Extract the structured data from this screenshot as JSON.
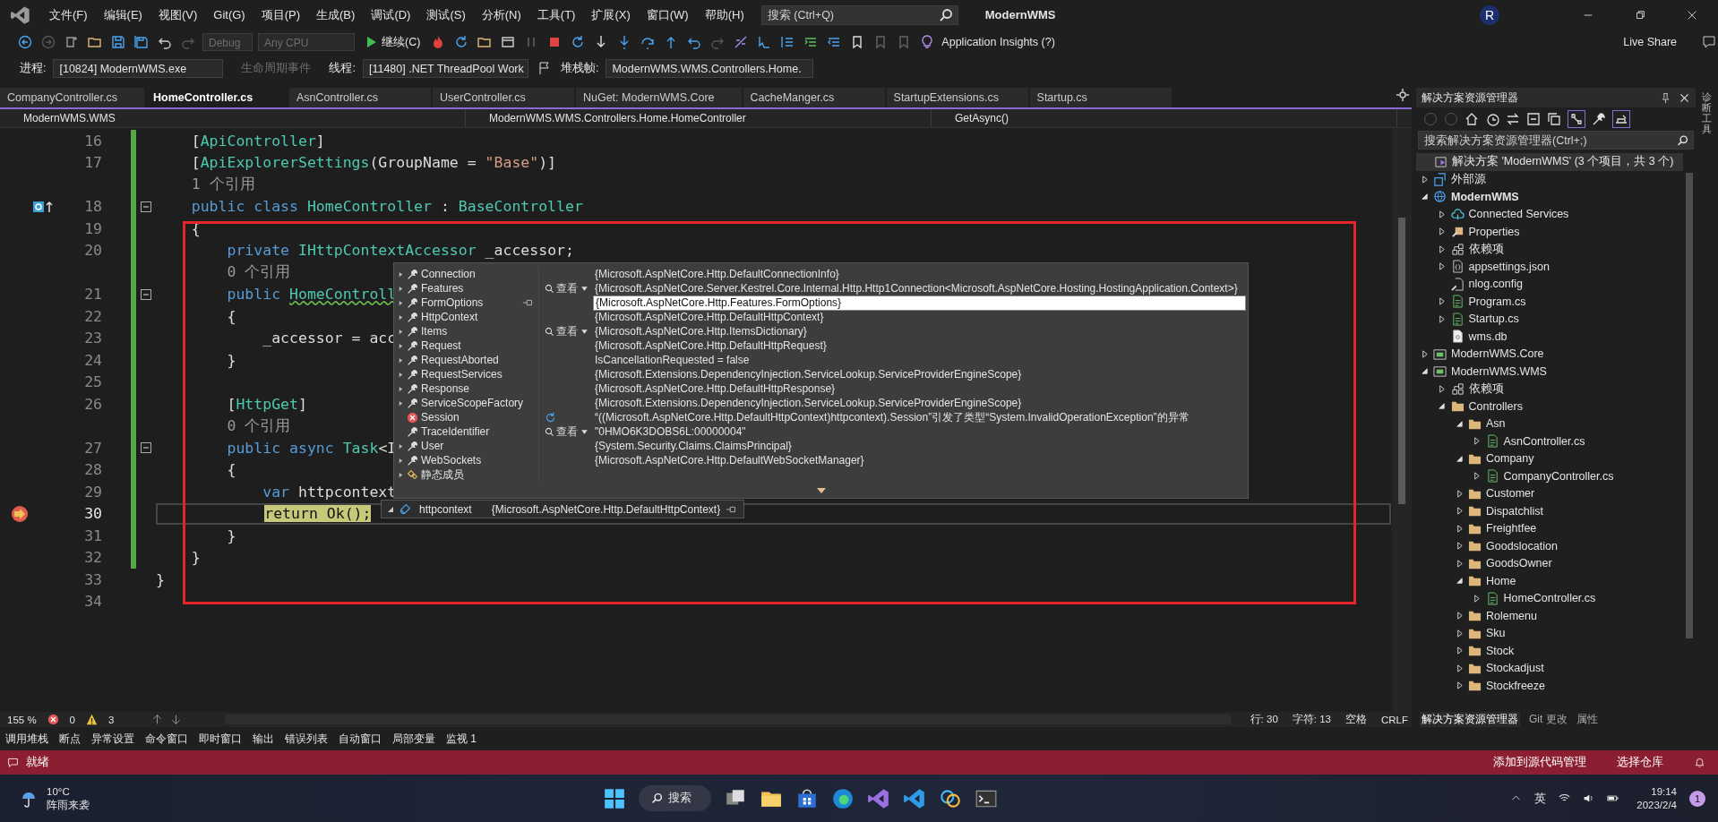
{
  "window": {
    "title": "ModernWMS",
    "account_initial": "R"
  },
  "menu": [
    "文件(F)",
    "编辑(E)",
    "视图(V)",
    "Git(G)",
    "项目(P)",
    "生成(B)",
    "调试(D)",
    "测试(S)",
    "分析(N)",
    "工具(T)",
    "扩展(X)",
    "窗口(W)",
    "帮助(H)"
  ],
  "search": {
    "placeholder": "搜索 (Ctrl+Q)"
  },
  "toolbar": {
    "configuration": {
      "value": "Debug",
      "disabled": true
    },
    "platform": {
      "value": "Any CPU",
      "disabled": true
    },
    "continue": "继续(C)",
    "insights": "Application Insights (?)",
    "live_share": "Live Share"
  },
  "debug_location": {
    "process_label": "进程:",
    "process": "[10824] ModernWMS.exe",
    "lifecycle": {
      "label": "生命周期事件",
      "disabled": true
    },
    "thread_label": "线程:",
    "thread": "[11480] .NET ThreadPool Work",
    "stack_label": "堆栈帧:",
    "stack_frame": "ModernWMS.WMS.Controllers.Home."
  },
  "tabs": [
    {
      "label": "CompanyController.cs",
      "selected": false
    },
    {
      "label": "HomeController.cs",
      "selected": true
    },
    {
      "label": "AsnController.cs",
      "selected": false
    },
    {
      "label": "UserController.cs",
      "selected": false
    },
    {
      "label": "NuGet: ModernWMS.Core",
      "selected": false
    },
    {
      "label": "CacheManger.cs",
      "selected": false
    },
    {
      "label": "StartupExtensions.cs",
      "selected": false
    },
    {
      "label": "Startup.cs",
      "selected": false
    }
  ],
  "navigation": {
    "project": "ModernWMS.WMS",
    "type": "ModernWMS.WMS.Controllers.Home.HomeController",
    "member": "GetAsync()"
  },
  "code_lines": [
    {
      "kind": "code",
      "number": "16",
      "changed": true,
      "tokens": [
        {
          "text": "    [",
          "kind": "plain"
        },
        {
          "text": "ApiController",
          "kind": "type"
        },
        {
          "text": "]",
          "kind": "plain"
        }
      ]
    },
    {
      "kind": "code",
      "number": "17",
      "changed": true,
      "tokens": [
        {
          "text": "    [",
          "kind": "plain"
        },
        {
          "text": "ApiExplorerSettings",
          "kind": "type"
        },
        {
          "text": "(GroupName = ",
          "kind": "plain"
        },
        {
          "text": "\"Base\"",
          "kind": "string"
        },
        {
          "text": ")]",
          "kind": "plain"
        }
      ]
    },
    {
      "kind": "lens",
      "changed": true,
      "text": "1 个引用"
    },
    {
      "kind": "code",
      "number": "18",
      "changed": true,
      "gutter": {
        "kind": "base-link"
      },
      "folded": false,
      "tokens": [
        {
          "text": "    public class ",
          "kind": "keyword"
        },
        {
          "text": "HomeController",
          "kind": "type"
        },
        {
          "text": " : ",
          "kind": "plain"
        },
        {
          "text": "BaseController",
          "kind": "type"
        }
      ]
    },
    {
      "kind": "code",
      "number": "19",
      "changed": true,
      "tokens": [
        {
          "text": "    {",
          "kind": "plain"
        }
      ]
    },
    {
      "kind": "code",
      "number": "20",
      "changed": true,
      "tokens": [
        {
          "text": "        private ",
          "kind": "keyword"
        },
        {
          "text": "IHttpContextAccessor",
          "kind": "type"
        },
        {
          "text": " _accessor;",
          "kind": "plain"
        }
      ]
    },
    {
      "kind": "lens",
      "changed": true,
      "text": "0 个引用"
    },
    {
      "kind": "code",
      "number": "21",
      "changed": true,
      "folded": false,
      "tokens": [
        {
          "text": "        public ",
          "kind": "keyword"
        },
        {
          "text": "HomeControll",
          "kind": "type",
          "warning": true
        }
      ]
    },
    {
      "kind": "code",
      "number": "22",
      "changed": true,
      "tokens": [
        {
          "text": "        {",
          "kind": "plain"
        }
      ]
    },
    {
      "kind": "code",
      "number": "23",
      "changed": true,
      "tokens": [
        {
          "text": "            _accessor = acc",
          "kind": "plain"
        }
      ]
    },
    {
      "kind": "code",
      "number": "24",
      "changed": true,
      "tokens": [
        {
          "text": "        }",
          "kind": "plain"
        }
      ]
    },
    {
      "kind": "code",
      "number": "25",
      "changed": true
    },
    {
      "kind": "code",
      "number": "26",
      "changed": true,
      "tokens": [
        {
          "text": "        [",
          "kind": "plain"
        },
        {
          "text": "HttpGet",
          "kind": "type"
        },
        {
          "text": "]",
          "kind": "plain"
        }
      ]
    },
    {
      "kind": "lens",
      "changed": true,
      "text": "0 个引用"
    },
    {
      "kind": "code",
      "number": "27",
      "changed": true,
      "folded": false,
      "tokens": [
        {
          "text": "        public async ",
          "kind": "keyword"
        },
        {
          "text": "Task",
          "kind": "type"
        },
        {
          "text": "<I",
          "kind": "plain"
        }
      ]
    },
    {
      "kind": "code",
      "number": "28",
      "changed": true,
      "tokens": [
        {
          "text": "        {",
          "kind": "plain"
        }
      ]
    },
    {
      "kind": "code",
      "number": "29",
      "changed": true,
      "tokens": [
        {
          "text": "            var",
          "kind": "keyword"
        },
        {
          "text": " httpcontext",
          "kind": "plain"
        }
      ]
    },
    {
      "kind": "code",
      "number": "30",
      "changed": true,
      "current": true,
      "gutter": {
        "kind": "current"
      },
      "tokens": [
        {
          "text": "            return",
          "kind": "keyword"
        },
        {
          "text": " Ok();",
          "kind": "plain"
        }
      ]
    },
    {
      "kind": "code",
      "number": "31",
      "changed": true,
      "tokens": [
        {
          "text": "        }",
          "kind": "plain"
        }
      ]
    },
    {
      "kind": "code",
      "number": "32",
      "changed": true,
      "tokens": [
        {
          "text": "    }",
          "kind": "plain"
        }
      ]
    },
    {
      "kind": "code",
      "number": "33",
      "changed": false,
      "tokens": [
        {
          "text": "}",
          "kind": "plain"
        }
      ]
    },
    {
      "kind": "code",
      "number": "34",
      "changed": false
    }
  ],
  "datatip": {
    "name": "httpcontext",
    "value": "{Microsoft.AspNetCore.Http.DefaultHttpContext}",
    "expanded": true,
    "members": [
      {
        "name": "Connection",
        "kind": "property",
        "expandable": true,
        "value": "{Microsoft.AspNetCore.Http.DefaultConnectionInfo}"
      },
      {
        "name": "Features",
        "kind": "property",
        "expandable": true,
        "action": "查看",
        "value": "{Microsoft.AspNetCore.Server.Kestrel.Core.Internal.Http.Http1Connection<Microsoft.AspNetCore.Hosting.HostingApplication.Context>}"
      },
      {
        "name": "FormOptions",
        "kind": "property",
        "expandable": true,
        "editing": true,
        "value": "{Microsoft.AspNetCore.Http.Features.FormOptions}"
      },
      {
        "name": "HttpContext",
        "kind": "property",
        "expandable": true,
        "value": "{Microsoft.AspNetCore.Http.DefaultHttpContext}"
      },
      {
        "name": "Items",
        "kind": "property",
        "expandable": true,
        "action": "查看",
        "value": "{Microsoft.AspNetCore.Http.ItemsDictionary}"
      },
      {
        "name": "Request",
        "kind": "property",
        "expandable": true,
        "value": "{Microsoft.AspNetCore.Http.DefaultHttpRequest}"
      },
      {
        "name": "RequestAborted",
        "kind": "property",
        "expandable": true,
        "value": "IsCancellationRequested = false"
      },
      {
        "name": "RequestServices",
        "kind": "property",
        "expandable": true,
        "value": "{Microsoft.Extensions.DependencyInjection.ServiceLookup.ServiceProviderEngineScope}"
      },
      {
        "name": "Response",
        "kind": "property",
        "expandable": true,
        "value": "{Microsoft.AspNetCore.Http.DefaultHttpResponse}"
      },
      {
        "name": "ServiceScopeFactory",
        "kind": "property",
        "expandable": true,
        "value": "{Microsoft.Extensions.DependencyInjection.ServiceLookup.ServiceProviderEngineScope}"
      },
      {
        "name": "Session",
        "kind": "error",
        "expandable": false,
        "refresh": true,
        "value": "“((Microsoft.AspNetCore.Http.DefaultHttpContext)httpcontext).Session”引发了类型“System.InvalidOperationException”的异常"
      },
      {
        "name": "TraceIdentifier",
        "kind": "property",
        "expandable": false,
        "action": "查看",
        "value": "\"0HMO6K3DOBS6L:00000004\""
      },
      {
        "name": "User",
        "kind": "property",
        "expandable": true,
        "value": "{System.Security.Claims.ClaimsPrincipal}"
      },
      {
        "name": "WebSockets",
        "kind": "property",
        "expandable": true,
        "value": "{Microsoft.AspNetCore.Http.DefaultWebSocketManager}"
      },
      {
        "name": "静态成员",
        "kind": "static",
        "expandable": true
      }
    ]
  },
  "editor_status": {
    "zoom": "155 %",
    "errors": "0",
    "warnings": "3",
    "line": "行: 30",
    "column": "字符: 13",
    "indent": "空格",
    "line_ending": "CRLF"
  },
  "solution_explorer": {
    "title": "解决方案资源管理器",
    "search": {
      "placeholder": "搜索解决方案资源管理器(Ctrl+;)"
    },
    "root": "解决方案 'ModernWMS' (3 个项目，共 3 个)",
    "items": [
      {
        "label": "外部源",
        "kind": "external",
        "expanded": false
      },
      {
        "label": "ModernWMS",
        "kind": "web",
        "expanded": true,
        "startup": true,
        "children": [
          {
            "label": "Connected Services",
            "kind": "connected",
            "expanded": false
          },
          {
            "label": "Properties",
            "kind": "properties",
            "expanded": false
          },
          {
            "label": "依赖项",
            "kind": "dependencies",
            "expanded": false
          },
          {
            "label": "appsettings.json",
            "kind": "json",
            "expanded": false
          },
          {
            "label": "nlog.config",
            "kind": "config"
          },
          {
            "label": "Program.cs",
            "kind": "cs",
            "expanded": false
          },
          {
            "label": "Startup.cs",
            "kind": "cs",
            "expanded": false
          },
          {
            "label": "wms.db",
            "kind": "db"
          }
        ]
      },
      {
        "label": "ModernWMS.Core",
        "kind": "project",
        "expanded": false
      },
      {
        "label": "ModernWMS.WMS",
        "kind": "project",
        "expanded": true,
        "children": [
          {
            "label": "依赖项",
            "kind": "dependencies",
            "expanded": false
          },
          {
            "label": "Controllers",
            "kind": "folder",
            "expanded": true,
            "children": [
              {
                "label": "Asn",
                "kind": "folder",
                "expanded": true,
                "children": [
                  {
                    "label": "AsnController.cs",
                    "kind": "cs",
                    "expanded": false
                  }
                ]
              },
              {
                "label": "Company",
                "kind": "folder",
                "expanded": true,
                "children": [
                  {
                    "label": "CompanyController.cs",
                    "kind": "cs",
                    "expanded": false
                  }
                ]
              },
              {
                "label": "Customer",
                "kind": "folder",
                "expanded": false
              },
              {
                "label": "Dispatchlist",
                "kind": "folder",
                "expanded": false
              },
              {
                "label": "Freightfee",
                "kind": "folder",
                "expanded": false
              },
              {
                "label": "Goodslocation",
                "kind": "folder",
                "expanded": false
              },
              {
                "label": "GoodsOwner",
                "kind": "folder",
                "expanded": false
              },
              {
                "label": "Home",
                "kind": "folder",
                "expanded": true,
                "children": [
                  {
                    "label": "HomeController.cs",
                    "kind": "cs",
                    "expanded": false
                  }
                ]
              },
              {
                "label": "Rolemenu",
                "kind": "folder",
                "expanded": false
              },
              {
                "label": "Sku",
                "kind": "folder",
                "expanded": false
              },
              {
                "label": "Stock",
                "kind": "folder",
                "expanded": false
              },
              {
                "label": "Stockadjust",
                "kind": "folder",
                "expanded": false
              },
              {
                "label": "Stockfreeze",
                "kind": "folder",
                "expanded": false
              }
            ]
          }
        ]
      }
    ]
  },
  "panel_tabs": [
    {
      "label": "解决方案资源管理器",
      "selected": true
    },
    {
      "label": "Git 更改",
      "selected": false
    },
    {
      "label": "属性",
      "selected": false
    }
  ],
  "side_strip": "诊断工具",
  "tool_windows": [
    "调用堆栈",
    "断点",
    "异常设置",
    "命令窗口",
    "即时窗口",
    "输出",
    "错误列表",
    "自动窗口",
    "局部变量",
    "监视 1"
  ],
  "status_bar": {
    "text": "就绪",
    "source_control": "添加到源代码管理",
    "repository": "选择仓库"
  },
  "taskbar": {
    "weather": {
      "temperature": "10°C",
      "text": "阵雨来袭"
    },
    "search": "搜索",
    "ime": "英",
    "time": "19:14",
    "date": "2023/2/4",
    "notifications": "1"
  }
}
